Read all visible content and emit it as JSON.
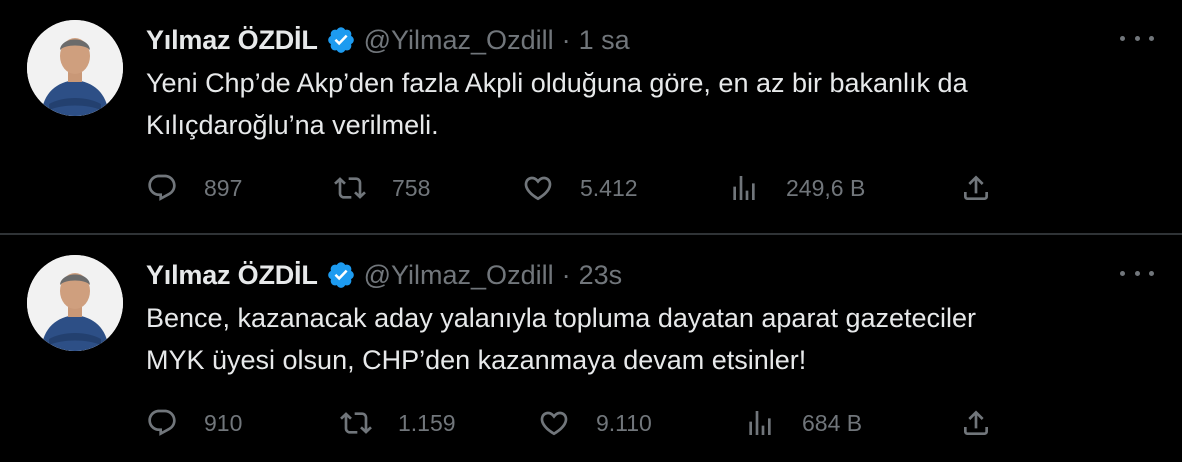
{
  "tweets": [
    {
      "author_name": "Yılmaz ÖZDİL",
      "handle": "@Yilmaz_Ozdill",
      "separator": "·",
      "time": "1 sa",
      "text": "Yeni Chp’de Akp’den fazla Akpli olduğuna göre, en az bir bakanlık da\nKılıçdaroğlu’na verilmeli.",
      "replies": "897",
      "retweets": "758",
      "likes": "5.412",
      "views": "249,6 B"
    },
    {
      "author_name": "Yılmaz ÖZDİL",
      "handle": "@Yilmaz_Ozdill",
      "separator": "·",
      "time": "23s",
      "text": "Bence, kazanacak aday yalanıyla topluma dayatan aparat gazeteciler\nMYK üyesi olsun, CHP’den kazanmaya devam etsinler!",
      "replies": "910",
      "retweets": "1.159",
      "likes": "9.110",
      "views": "684 B"
    }
  ],
  "icons": {
    "verified": "verified-badge-icon",
    "more": "more-options-icon",
    "reply": "reply-icon",
    "retweet": "retweet-icon",
    "like": "heart-icon",
    "views": "views-chart-icon",
    "share": "share-icon"
  },
  "colors": {
    "background": "#000000",
    "text": "#e7e9ea",
    "muted": "#71767b",
    "verified": "#1d9bf0",
    "divider": "#2f3336"
  }
}
